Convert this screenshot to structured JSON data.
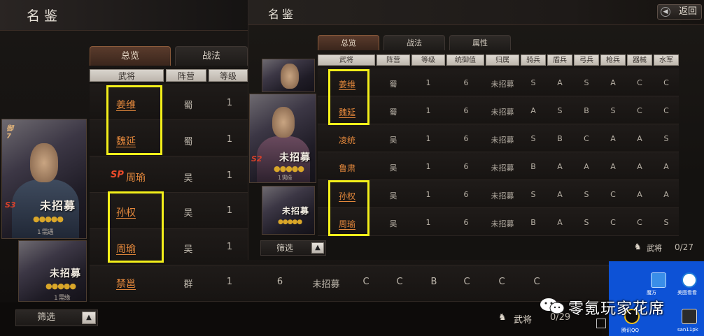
{
  "back_window": {
    "title": "名鉴",
    "tabs": [
      "总览",
      "战法"
    ],
    "headers": [
      "武将",
      "阵营",
      "等级"
    ],
    "rows": [
      {
        "name": "姜维",
        "camp": "蜀",
        "level": "1",
        "sp": ""
      },
      {
        "name": "魏延",
        "camp": "蜀",
        "level": "1",
        "sp": ""
      },
      {
        "name": "周瑜",
        "camp": "吴",
        "level": "1",
        "sp": "SP"
      },
      {
        "name": "孙权",
        "camp": "吴",
        "level": "1",
        "sp": ""
      },
      {
        "name": "周瑜",
        "camp": "吴",
        "level": "1",
        "sp": ""
      },
      {
        "name": "禁邕",
        "camp": "群",
        "level": "1",
        "sp": "",
        "cost": "6",
        "status": "未招募",
        "grades": [
          "C",
          "C",
          "B",
          "C",
          "C",
          "C"
        ]
      }
    ],
    "cards": [
      {
        "text": "未招募",
        "corner": "S3",
        "sub": "1 需遇",
        "badge": "御\n7"
      },
      {
        "text": "未招募",
        "corner": "",
        "sub": "1 需缘",
        "badge": ""
      }
    ],
    "filter_label": "筛选",
    "general_label": "武将",
    "count": "0/29"
  },
  "front_window": {
    "title": "名鉴",
    "back_label": "返回",
    "tabs": [
      "总览",
      "战法",
      "属性"
    ],
    "headers": [
      "武将",
      "阵营",
      "等级",
      "统御值",
      "归属",
      "骑兵",
      "盾兵",
      "弓兵",
      "枪兵",
      "器械",
      "水军"
    ],
    "rows": [
      {
        "name": "姜维",
        "camp": "蜀",
        "level": "1",
        "cost": "6",
        "status": "未招募",
        "grades": [
          "S",
          "A",
          "S",
          "A",
          "C",
          "C"
        ]
      },
      {
        "name": "魏延",
        "camp": "蜀",
        "level": "1",
        "cost": "6",
        "status": "未招募",
        "grades": [
          "A",
          "S",
          "B",
          "S",
          "C",
          "C"
        ]
      },
      {
        "name": "凌统",
        "camp": "吴",
        "level": "1",
        "cost": "6",
        "status": "未招募",
        "grades": [
          "S",
          "B",
          "C",
          "A",
          "A",
          "S"
        ]
      },
      {
        "name": "鲁肃",
        "camp": "吴",
        "level": "1",
        "cost": "6",
        "status": "未招募",
        "grades": [
          "B",
          "A",
          "A",
          "A",
          "A",
          "A"
        ]
      },
      {
        "name": "孙权",
        "camp": "吴",
        "level": "1",
        "cost": "6",
        "status": "未招募",
        "grades": [
          "S",
          "A",
          "S",
          "C",
          "A",
          "A"
        ]
      },
      {
        "name": "周瑜",
        "camp": "吴",
        "level": "1",
        "cost": "6",
        "status": "未招募",
        "grades": [
          "B",
          "A",
          "S",
          "C",
          "C",
          "S"
        ]
      }
    ],
    "cards": [
      {
        "text": "",
        "corner": "",
        "sub": ""
      },
      {
        "text": "未招募",
        "corner": "S2",
        "sub": "1 需缘"
      },
      {
        "text": "未招募",
        "corner": "",
        "sub": ""
      }
    ],
    "filter_label": "筛选",
    "general_label": "武将",
    "count": "0/27"
  },
  "desktop": {
    "labels": [
      "腾讯QQ",
      "san11pk",
      "美图看看",
      "魔方"
    ],
    "watermark": "零氪玩家花席"
  },
  "colors": {
    "highlight": "#f3ef1a",
    "name_link": "#e4883c",
    "tab_active": "#5a3b2c",
    "desktop_bg": "#0d52d6"
  }
}
